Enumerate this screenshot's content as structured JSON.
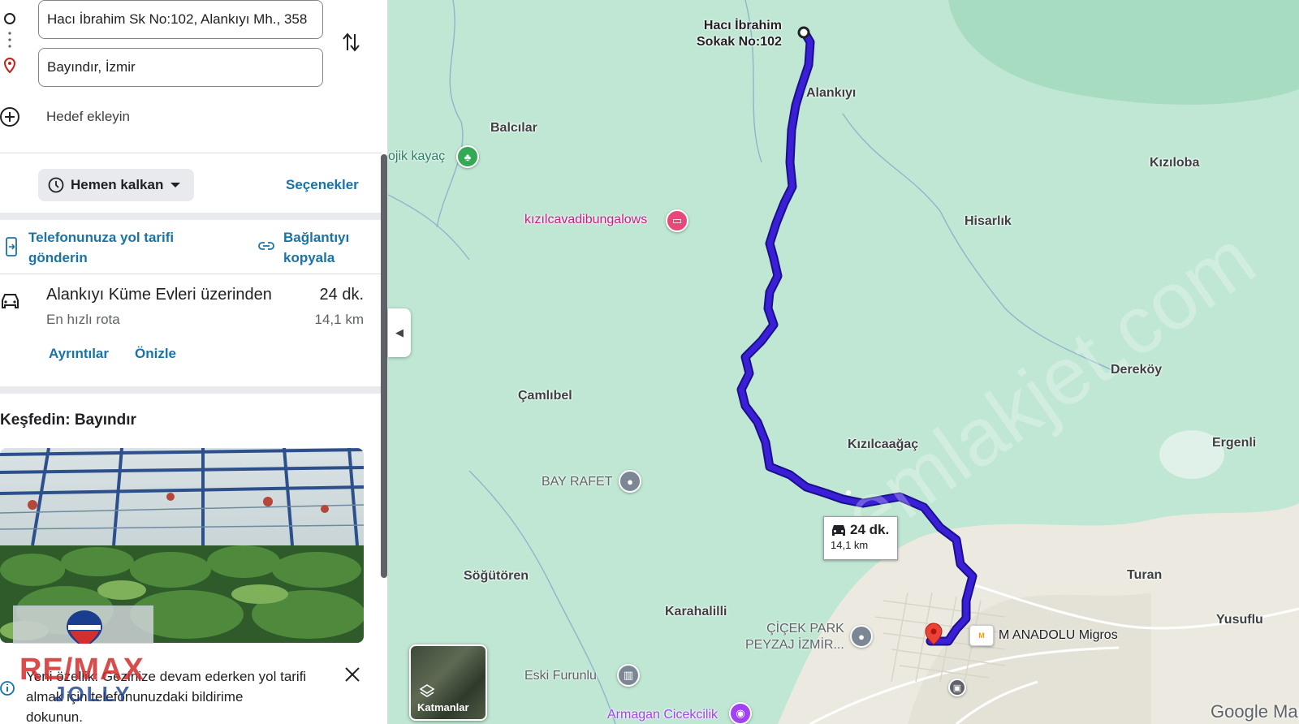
{
  "directions": {
    "origin_value": "Hacı İbrahim Sk No:102, Alankıyı Mh., 358",
    "destination_value": "Bayındır, İzmir",
    "add_destination_label": "Hedef ekleyin"
  },
  "options": {
    "depart_label": "Hemen kalkan",
    "options_label": "Seçenekler"
  },
  "share": {
    "send_to_phone_line1": "Telefonunuza yol tarifi",
    "send_to_phone_line2": "gönderin",
    "copy_link_line1": "Bağlantıyı",
    "copy_link_line2": "kopyala"
  },
  "route": {
    "via": "Alankıyı Küme Evleri üzerinden",
    "duration": "24 dk.",
    "subtitle": "En hızlı rota",
    "distance": "14,1 km",
    "details_label": "Ayrıntılar",
    "preview_label": "Önizle"
  },
  "explore": {
    "title": "Keşfedin: Bayındır"
  },
  "notice": {
    "line1": "Yeni özellik: Gezinize devam ederken yol tarifi",
    "line2": "almak için telefonunuzdaki bildirime",
    "line3": "dokunun."
  },
  "overlay_logo": {
    "brand": "RE/MAX",
    "office": "JOLLY"
  },
  "map": {
    "origin_label_line1": "Hacı İbrahim",
    "origin_label_line2": "Sokak No:102",
    "eta_duration": "24 dk.",
    "eta_distance": "14,1 km",
    "layers_label": "Katmanlar",
    "watermark": "emlakjet.com",
    "attribution": "Google Maps",
    "places": {
      "alankiyi": "Alankıyı",
      "balcilar": "Balcılar",
      "kiziloba": "Kızıloba",
      "hisarlik": "Hisarlık",
      "derekoy": "Dereköy",
      "camlibel": "Çamlıbel",
      "kizilcaagac": "Kızılcaağaç",
      "ergenli": "Ergenli",
      "sogutoren": "Söğütören",
      "turan": "Turan",
      "karahalilli": "Karahalilli",
      "yusuflu": "Yusuflu"
    },
    "pois": {
      "kayac": "ojik kayaç",
      "bungalows": "kızılcavadibungalows",
      "bayrafet": "BAY RAFET",
      "cicekpark1": "ÇİÇEK PARK",
      "cicekpark2": "PEYZAJ İZMİR...",
      "migros": "M ANADOLU Migros",
      "eskifurunlu": "Eski Furunlu",
      "armagan": "Armagan Cicekcilik"
    },
    "colors": {
      "route": "#3b1fd6",
      "terrain": "#bfe7d3",
      "forest": "#a8dcc1",
      "urban": "#eceae0"
    }
  }
}
